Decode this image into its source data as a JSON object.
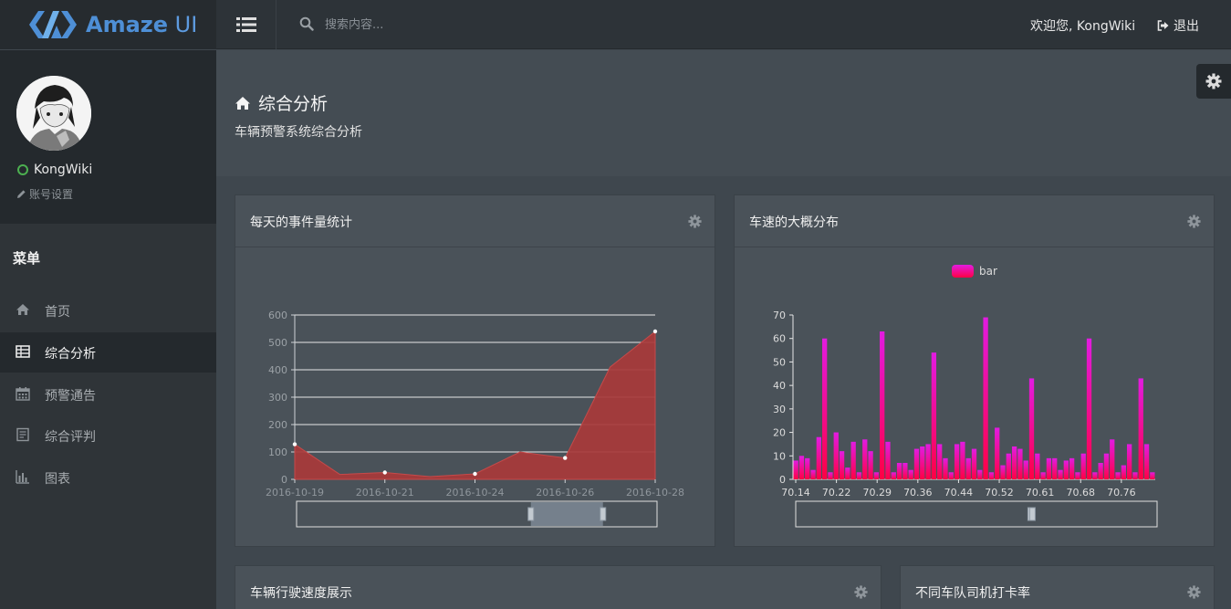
{
  "brand": {
    "name_bold": "Amaze",
    "name_light": "UI",
    "accent": "#4e8fd6"
  },
  "header": {
    "search_placeholder": "搜索内容...",
    "welcome": "欢迎您, KongWiki",
    "logout": "退出"
  },
  "sidebar": {
    "username": "KongWiki",
    "status_color": "#4caf50",
    "account_settings": "账号设置",
    "menu_title": "菜单",
    "items": [
      {
        "label": "首页",
        "icon": "home-icon"
      },
      {
        "label": "综合分析",
        "icon": "table-icon",
        "active": true
      },
      {
        "label": "预警通告",
        "icon": "calendar-icon"
      },
      {
        "label": "综合评判",
        "icon": "document-icon"
      },
      {
        "label": "图表",
        "icon": "bar-chart-icon"
      }
    ]
  },
  "page": {
    "title": "综合分析",
    "subtitle": "车辆预警系统综合分析"
  },
  "panels": [
    {
      "title": "每天的事件量统计"
    },
    {
      "title": "车速的大概分布"
    },
    {
      "title": "车辆行驶速度展示"
    },
    {
      "title": "不同车队司机打卡率"
    }
  ],
  "chart_data": [
    {
      "type": "area",
      "color": "#a83a3a",
      "x_tick_labels": [
        "2016-10-19",
        "2016-10-21",
        "2016-10-24",
        "2016-10-26",
        "2016-10-28"
      ],
      "x": [
        0,
        1,
        2,
        3,
        4,
        5,
        6,
        7,
        8
      ],
      "y": [
        128,
        18,
        25,
        10,
        20,
        100,
        78,
        410,
        540
      ],
      "marked_points": [
        0,
        2,
        4,
        6,
        8
      ],
      "ylim": [
        0,
        600
      ],
      "y_ticks": [
        0,
        100,
        200,
        300,
        400,
        500,
        600
      ],
      "grid": true,
      "datazoom": {
        "start": 0.65,
        "end": 0.85
      }
    },
    {
      "type": "bar",
      "legend": [
        "bar"
      ],
      "legend_position": "top-center",
      "color_top": "#e21be1",
      "color_bottom": "#ff0044",
      "x_tick_labels": [
        "70.14",
        "70.22",
        "70.29",
        "70.36",
        "70.44",
        "70.52",
        "70.61",
        "70.68",
        "70.76"
      ],
      "values": [
        8,
        10,
        9,
        4,
        18,
        60,
        3,
        20,
        12,
        5,
        16,
        3,
        17,
        12,
        3,
        63,
        16,
        3,
        7,
        7,
        4,
        13,
        14,
        15,
        54,
        15,
        9,
        3,
        15,
        16,
        9,
        13,
        4,
        69,
        3,
        22,
        6,
        11,
        14,
        13,
        8,
        43,
        11,
        3,
        9,
        9,
        4,
        8,
        9,
        3,
        11,
        60,
        3,
        7,
        11,
        17,
        3,
        6,
        15,
        3,
        43,
        15,
        3
      ],
      "ylim": [
        0,
        70
      ],
      "y_ticks": [
        0,
        10,
        20,
        30,
        40,
        50,
        60,
        70
      ],
      "datazoom": {
        "start": 0.65,
        "end": 0.65
      }
    }
  ]
}
